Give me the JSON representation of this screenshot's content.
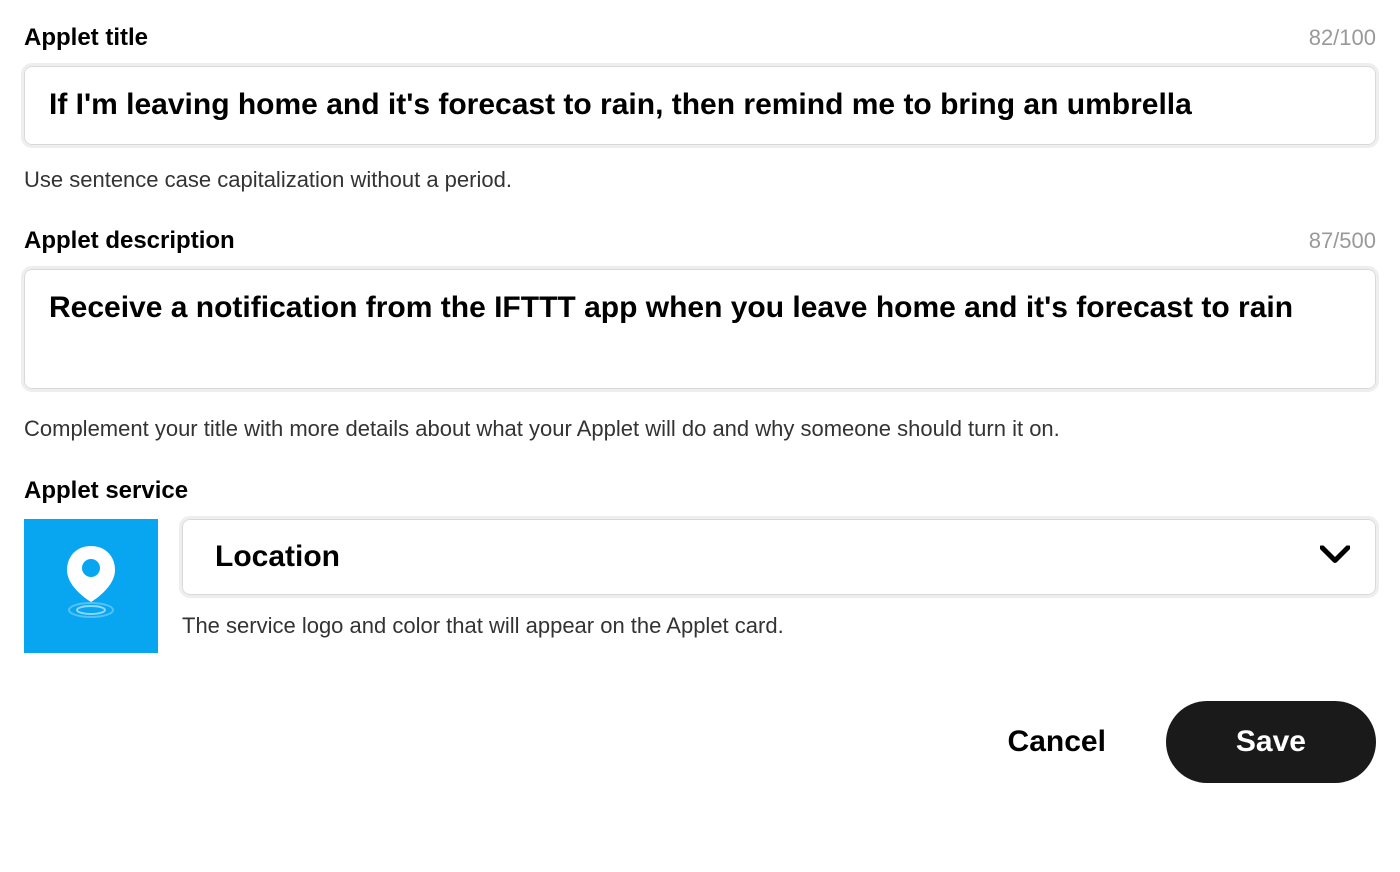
{
  "titleSection": {
    "label": "Applet title",
    "counter": "82/100",
    "value": "If I'm leaving home and it's forecast to rain, then remind me to bring an umbrella",
    "helper": "Use sentence case capitalization without a period."
  },
  "descriptionSection": {
    "label": "Applet description",
    "counter": "87/500",
    "value": "Receive a notification from the IFTTT app when you leave home and it's forecast to rain",
    "helper": "Complement your title with more details about what your Applet will do and why someone should turn it on."
  },
  "serviceSection": {
    "label": "Applet service",
    "selected": "Location",
    "helper": "The service logo and color that will appear on the Applet card."
  },
  "actions": {
    "cancel": "Cancel",
    "save": "Save"
  }
}
